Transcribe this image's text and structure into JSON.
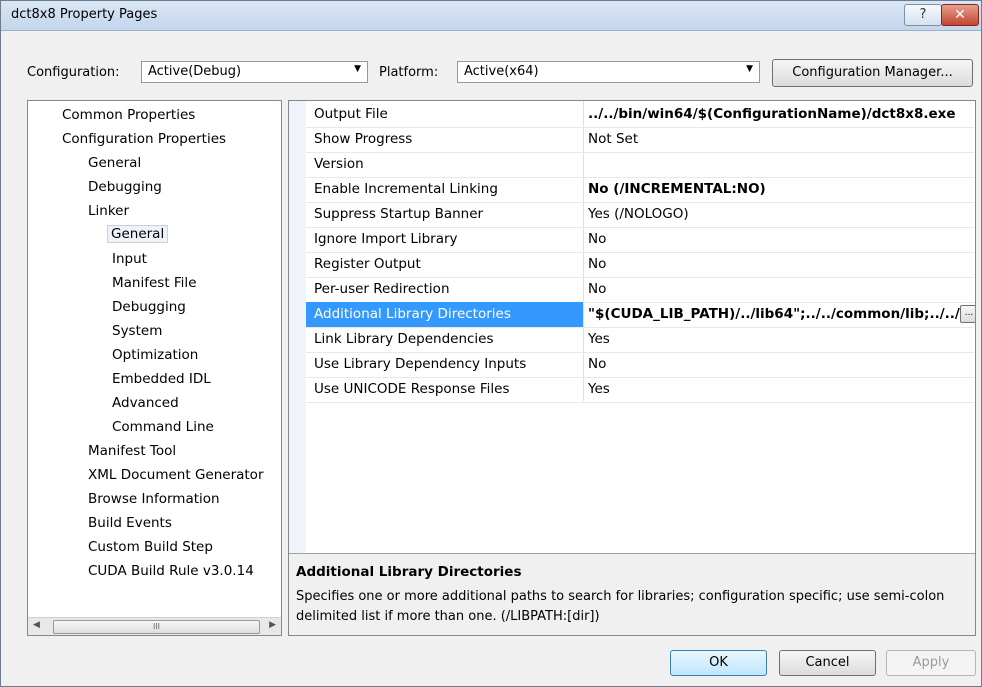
{
  "window": {
    "title": "dct8x8 Property Pages",
    "help_glyph": "?",
    "close_glyph": "✕"
  },
  "config": {
    "configuration_label": "Configuration:",
    "configuration_value": "Active(Debug)",
    "platform_label": "Platform:",
    "platform_value": "Active(x64)",
    "manager_button": "Configuration Manager..."
  },
  "tree": {
    "items": [
      "Common Properties",
      "Configuration Properties",
      "General",
      "Debugging",
      "Linker",
      "General",
      "Input",
      "Manifest File",
      "Debugging",
      "System",
      "Optimization",
      "Embedded IDL",
      "Advanced",
      "Command Line",
      "Manifest Tool",
      "XML Document Generator",
      "Browse Information",
      "Build Events",
      "Custom Build Step",
      "CUDA Build Rule v3.0.14"
    ],
    "scroll_thumb_glyph": "III"
  },
  "properties": [
    {
      "name": "Output File",
      "value": "../../bin/win64/$(ConfigurationName)/dct8x8.exe"
    },
    {
      "name": "Show Progress",
      "value": "Not Set"
    },
    {
      "name": "Version",
      "value": ""
    },
    {
      "name": "Enable Incremental Linking",
      "value": "No (/INCREMENTAL:NO)"
    },
    {
      "name": "Suppress Startup Banner",
      "value": "Yes (/NOLOGO)"
    },
    {
      "name": "Ignore Import Library",
      "value": "No"
    },
    {
      "name": "Register Output",
      "value": "No"
    },
    {
      "name": "Per-user Redirection",
      "value": "No"
    },
    {
      "name": "Additional Library Directories",
      "value": "\"$(CUDA_LIB_PATH)/../lib64\";../../common/lib;../../"
    },
    {
      "name": "Link Library Dependencies",
      "value": "Yes"
    },
    {
      "name": "Use Library Dependency Inputs",
      "value": "No"
    },
    {
      "name": "Use UNICODE Response Files",
      "value": "Yes"
    }
  ],
  "ellipsis_label": "...",
  "description": {
    "title": "Additional Library Directories",
    "text": "Specifies one or more additional paths to search for libraries; configuration specific; use semi-colon delimited list if more than one.    (/LIBPATH:[dir])"
  },
  "buttons": {
    "ok": "OK",
    "cancel": "Cancel",
    "apply": "Apply"
  },
  "colors": {
    "selection": "#3399ff",
    "titlebar": "#c4d6ec",
    "close": "#c5452e"
  }
}
